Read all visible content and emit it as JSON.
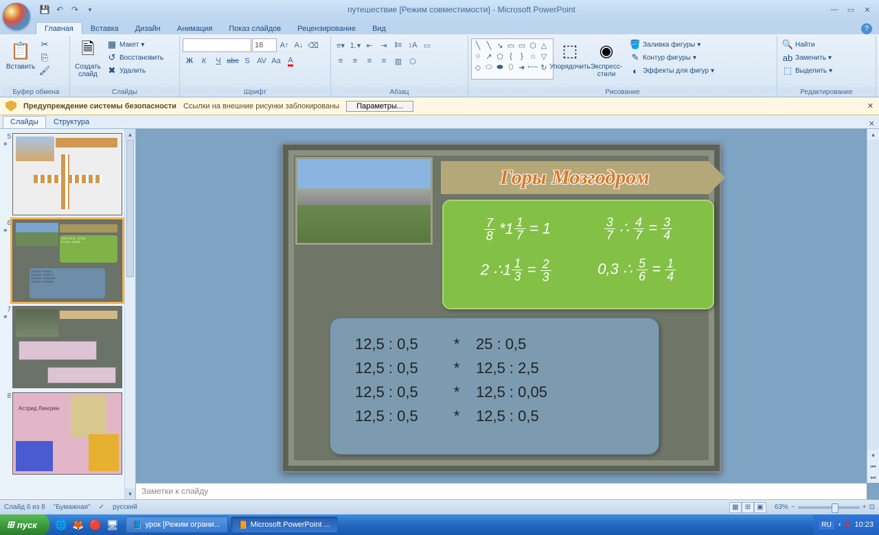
{
  "titlebar": {
    "title": "путешествие [Режим совместимости] - Microsoft PowerPoint"
  },
  "tabs": [
    "Главная",
    "Вставка",
    "Дизайн",
    "Анимация",
    "Показ слайдов",
    "Рецензирование",
    "Вид"
  ],
  "ribbon": {
    "clipboard": {
      "label": "Буфер обмена",
      "paste": "Вставить"
    },
    "slides": {
      "label": "Слайды",
      "new": "Создать слайд",
      "layout": "Макет",
      "reset": "Восстановить",
      "delete": "Удалить"
    },
    "font": {
      "label": "Шрифт",
      "size": "18"
    },
    "paragraph": {
      "label": "Абзац"
    },
    "drawing": {
      "label": "Рисование",
      "arrange": "Упорядочить",
      "quick": "Экспресс-стили",
      "fill": "Заливка фигуры",
      "outline": "Контур фигуры",
      "effects": "Эффекты для фигур"
    },
    "editing": {
      "label": "Редактирование",
      "find": "Найти",
      "replace": "Заменить",
      "select": "Выделить"
    }
  },
  "security": {
    "title": "Предупреждение системы безопасности",
    "msg": "Ссылки на внешние рисунки заблокированы",
    "btn": "Параметры..."
  },
  "panel": {
    "tab1": "Слайды",
    "tab2": "Структура"
  },
  "thumbs": [
    {
      "num": "5"
    },
    {
      "num": "6"
    },
    {
      "num": "7"
    },
    {
      "num": "8"
    }
  ],
  "thumb8txt": "Астрид Лингрен",
  "slide": {
    "title": "Горы Мозгодром",
    "green_r1_a": {
      "n1": "7",
      "d1": "8",
      "op": "*",
      "w": "1",
      "n2": "1",
      "d2": "7",
      "eq": "= 1"
    },
    "green_r1_b": {
      "n1": "3",
      "d1": "7",
      "op": "∴",
      "n2": "4",
      "d2": "7",
      "eq": "=",
      "n3": "3",
      "d3": "4"
    },
    "green_r2_a": {
      "w1": "2",
      "op": "∴",
      "w2": "1",
      "n": "1",
      "d": "3",
      "eq": "=",
      "n2": "2",
      "d2": "3"
    },
    "green_r2_b": {
      "w1": "0,3",
      "op": "∴",
      "n": "5",
      "d": "6",
      "eq": "=",
      "n2": "1",
      "d2": "4"
    },
    "blue": [
      [
        "12,5 : 0,5",
        "*",
        "25 : 0,5"
      ],
      [
        "12,5 : 0,5",
        "*",
        "12,5 : 2,5"
      ],
      [
        "12,5 : 0,5",
        "*",
        "12,5 : 0,05"
      ],
      [
        "12,5 : 0,5",
        "*",
        "12,5 : 0,5"
      ]
    ]
  },
  "notes": "Заметки к слайду",
  "status": {
    "slide": "Слайд 6 из 8",
    "theme": "\"Бумажная\"",
    "lang": "русский",
    "zoom": "63%"
  },
  "taskbar": {
    "start": "пуск",
    "btn1": "урок [Режим ограни...",
    "btn2": "Microsoft PowerPoint ...",
    "lang": "RU",
    "time": "10:23"
  }
}
